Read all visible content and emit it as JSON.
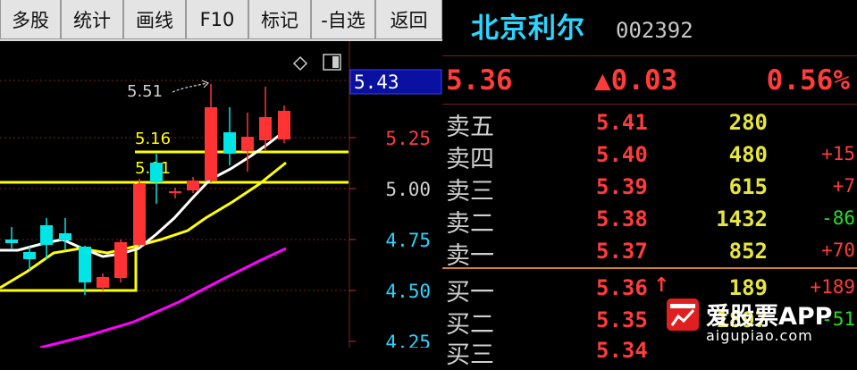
{
  "toolbar": {
    "buttons": [
      "多股",
      "统计",
      "画线",
      "F10",
      "标记",
      "-自选",
      "返回"
    ]
  },
  "chart": {
    "y_ticks": [
      "5.25",
      "5.00",
      "4.75",
      "4.50",
      "4.25"
    ],
    "cursor_price": "5.43",
    "high_annotation": "5.51",
    "box_top_label": "5.16",
    "box_bottom_label": "5.01",
    "colors": {
      "up": "#ff3333",
      "down": "#00e5e5",
      "ma5": "#ffffff",
      "ma10": "#ffff00",
      "ma20": "#ff00ff",
      "box": "#ffff00"
    }
  },
  "quote": {
    "name": "北京利尔",
    "code": "002392",
    "price": "5.36",
    "change": "▲0.03",
    "change_pct": "0.56%"
  },
  "orderbook": {
    "asks": [
      {
        "label": "卖五",
        "price": "5.41",
        "volume": "280",
        "change": ""
      },
      {
        "label": "卖四",
        "price": "5.40",
        "volume": "480",
        "change": "+15"
      },
      {
        "label": "卖三",
        "price": "5.39",
        "volume": "615",
        "change": "+7"
      },
      {
        "label": "卖二",
        "price": "5.38",
        "volume": "1432",
        "change": "-86"
      },
      {
        "label": "卖一",
        "price": "5.37",
        "volume": "852",
        "change": "+70"
      }
    ],
    "bids": [
      {
        "label": "买一",
        "price": "5.36",
        "volume": "189",
        "change": "+189",
        "arrow": "↑"
      },
      {
        "label": "买二",
        "price": "5.35",
        "volume": "1897",
        "change": "-51"
      },
      {
        "label": "买三",
        "price": "5.34",
        "volume": "",
        "change": ""
      }
    ]
  },
  "watermark": {
    "brand": "爱股票APP",
    "url": "aigupiao.com"
  }
}
